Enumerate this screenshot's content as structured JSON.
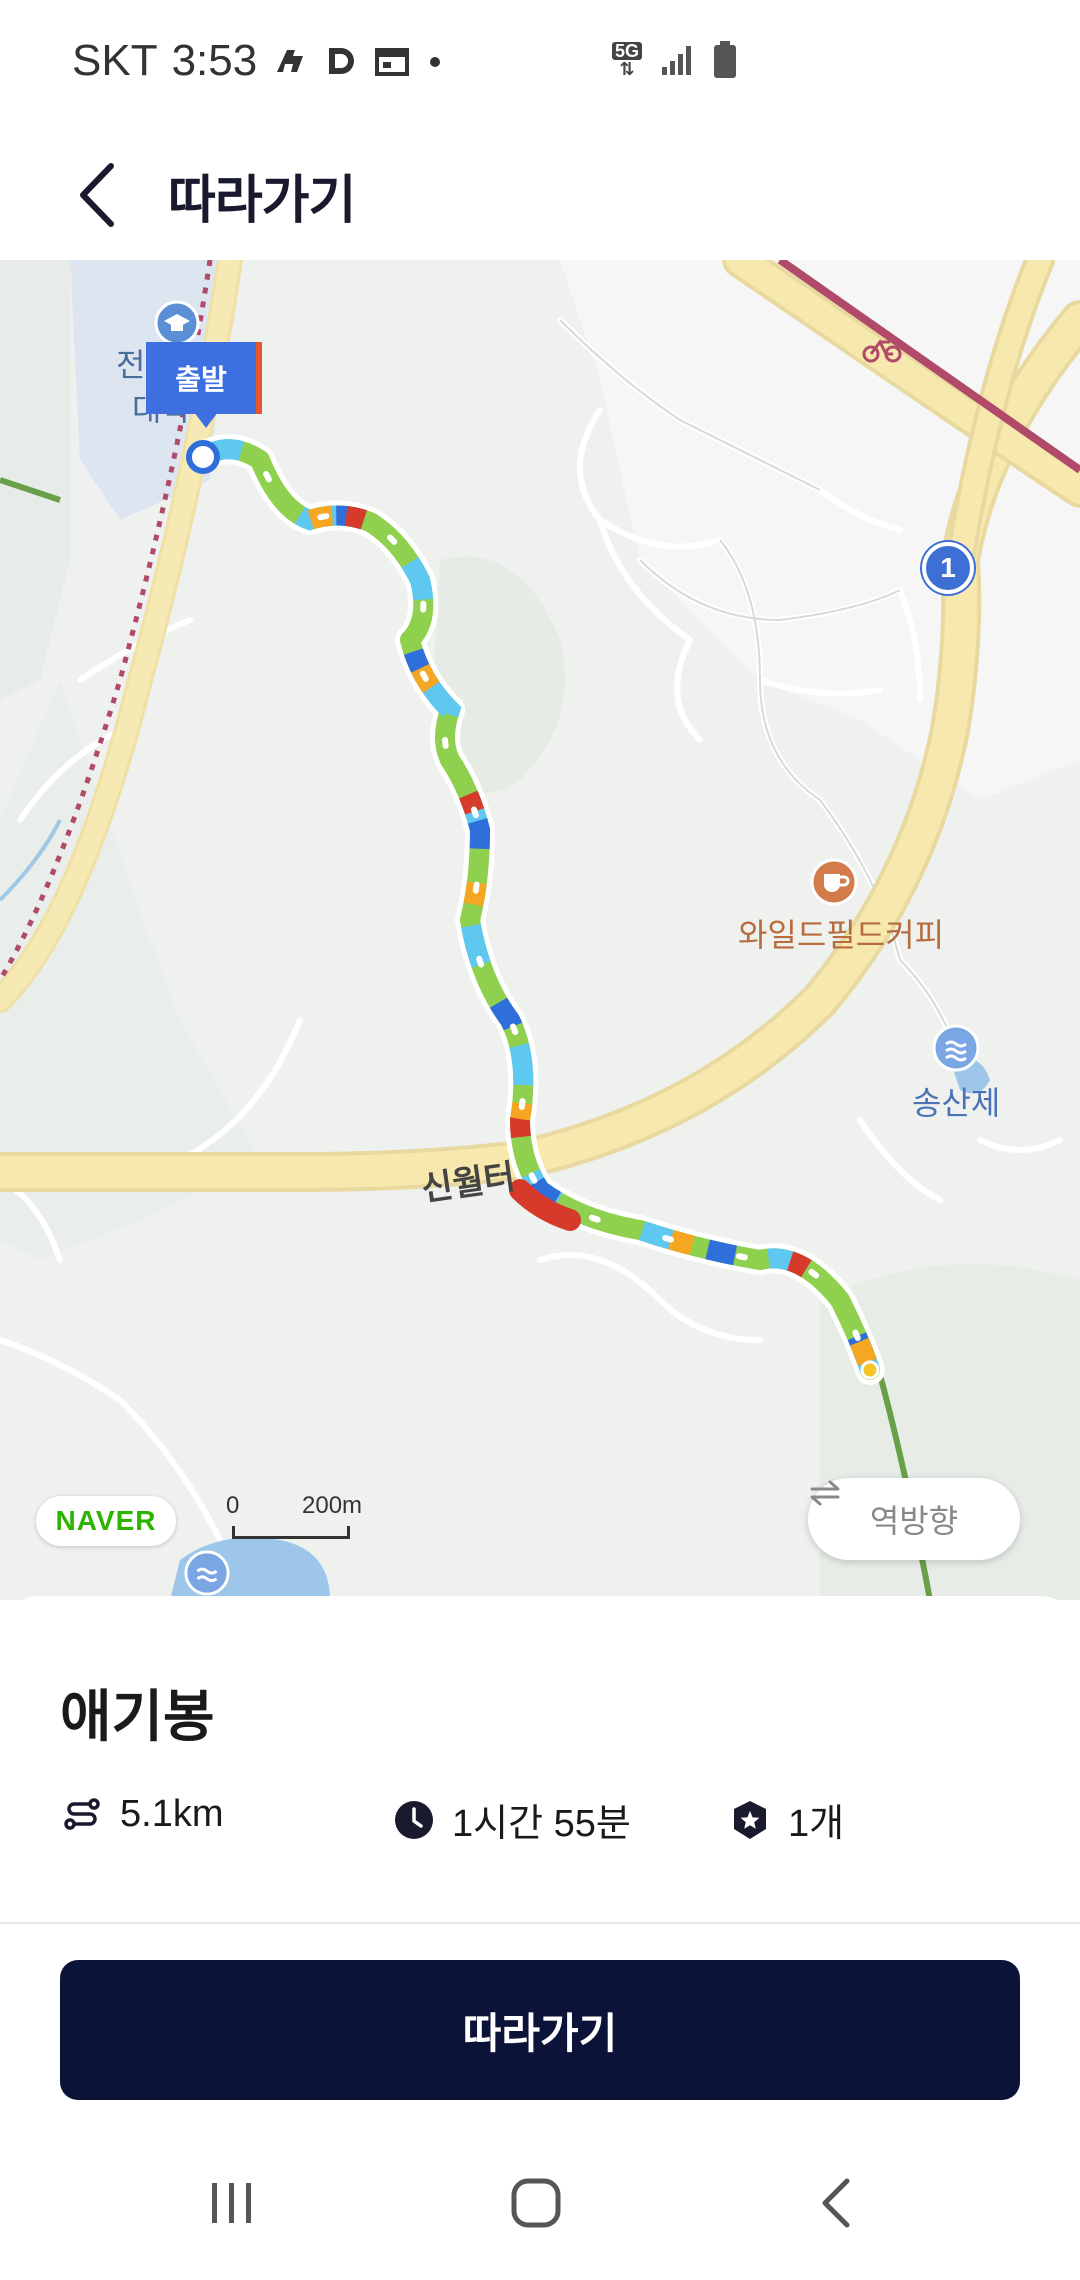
{
  "status_bar": {
    "carrier": "SKT",
    "time": "3:53",
    "network": "5G",
    "icons": [
      "navigation-icon",
      "d-app-icon",
      "calendar-icon",
      "dot-icon",
      "5g-icon",
      "signal-icon",
      "battery-icon"
    ]
  },
  "header": {
    "title": "따라가기",
    "back_icon": "chevron-left-icon"
  },
  "map": {
    "start_label": "출발",
    "labels": {
      "school_partial_1": "전",
      "school_partial_2": "대학",
      "cafe": "와일드필드커피",
      "reservoir": "송산제",
      "pass": "신월터",
      "route_number": "1"
    },
    "logo": "NAVER",
    "scale": {
      "zero": "0",
      "distance": "200m"
    },
    "reverse_button_label": "역방향",
    "colors": {
      "road": "#f7e6a8",
      "rail": "#b04a68",
      "route_blue": "#2f6fdc",
      "route_green": "#8fd14f",
      "route_cyan": "#5ec8f0",
      "route_orange": "#f5a623",
      "route_red": "#d63a2a"
    }
  },
  "course": {
    "name": "애기봉",
    "distance": "5.1km",
    "duration": "1시간 55분",
    "count": "1개"
  },
  "actions": {
    "follow_button": "따라가기"
  },
  "nav_bar": {
    "icons": [
      "recent-apps-icon",
      "home-icon",
      "back-icon"
    ]
  }
}
